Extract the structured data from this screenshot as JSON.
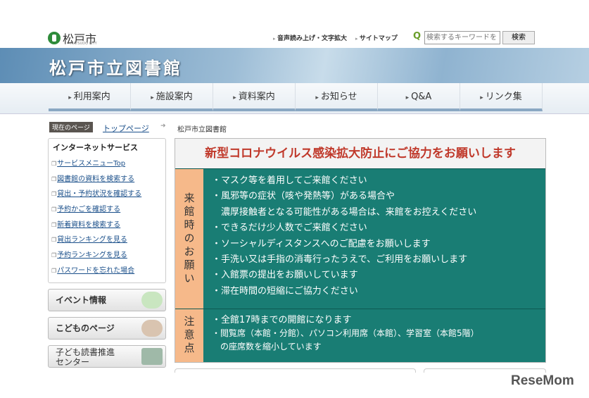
{
  "header": {
    "logo": "松戸市",
    "logo_sub": "MATSUDO CITY",
    "links": [
      "音声読み上げ・文字拡大",
      "サイトマップ"
    ],
    "search_placeholder": "検索するキーワードを",
    "search_button": "検索"
  },
  "banner": {
    "title": "松戸市立図書館"
  },
  "nav": [
    "利用案内",
    "施設案内",
    "資料案内",
    "お知らせ",
    "Q&A",
    "リンク集"
  ],
  "breadcrumb": {
    "label": "現在のページ",
    "top": "トップページ",
    "current": "松戸市立図書館"
  },
  "sidebar": {
    "title": "インターネットサービス",
    "links": [
      "サービスメニューTop",
      "図書館の資料を検索する",
      "貸出・予約状況を確認する",
      "予約かごを確認する",
      "新着資料を検索する",
      "貸出ランキングを見る",
      "予約ランキングを見る",
      "パスワードを忘れた場合"
    ],
    "buttons": [
      "イベント情報",
      "こどものページ",
      "子ども読書推進センター"
    ]
  },
  "notice": {
    "title": "新型コロナウイルス感染拡大防止にご協力をお願いします",
    "sections": [
      {
        "label": "来館時のお願い",
        "items": [
          "・マスク等を着用してご来館ください",
          "・風邪等の症状（咳や発熱等）がある場合や",
          "　濃厚接触者となる可能性がある場合は、来館をお控えください",
          "・できるだけ少人数でご来館ください",
          "・ソーシャルディスタンスへのご配慮をお願いします",
          "・手洗い又は手指の消毒行ったうえで、ご利用をお願いします",
          "・入館票の提出をお願いしています",
          "・滞在時間の短縮にご協力ください"
        ]
      },
      {
        "label": "注意点",
        "items": [
          "・全館17時までの開館になります",
          "・閲覧席（本館・分館）、パソコン利用席（本館）、学習室（本館5階）",
          "　の座席数を縮小しています"
        ]
      }
    ]
  },
  "watermark": "ReseMom"
}
